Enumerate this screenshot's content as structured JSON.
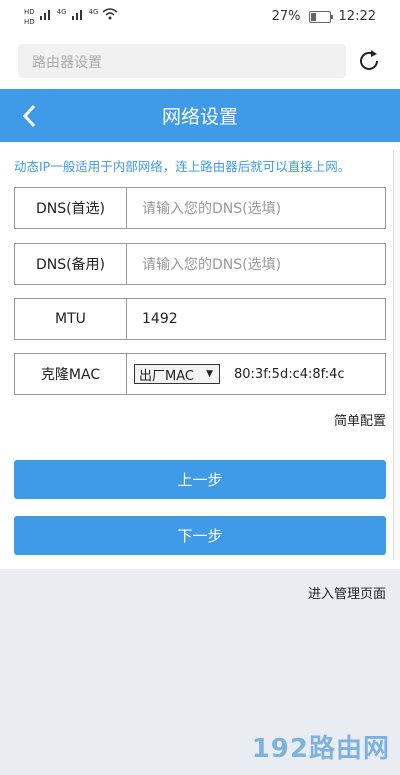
{
  "status": {
    "net1": "HD",
    "net2": "HD",
    "net3": "4G",
    "net4": "4G",
    "battery": "27%",
    "time": "12:22"
  },
  "browser": {
    "url_placeholder": "路由器设置"
  },
  "header": {
    "title": "网络设置"
  },
  "info_text": "动态IP一般适用于内部网络，连上路由器后就可以直接上网。",
  "form": {
    "dns_primary": {
      "label": "DNS(首选)",
      "placeholder": "请输入您的DNS(选填)"
    },
    "dns_backup": {
      "label": "DNS(备用)",
      "placeholder": "请输入您的DNS(选填)"
    },
    "mtu": {
      "label": "MTU",
      "value": "1492"
    },
    "clone_mac": {
      "label": "克隆MAC",
      "selected": "出厂MAC",
      "mac": "80:3f:5d:c4:8f:4c"
    }
  },
  "simple_config": "简单配置",
  "buttons": {
    "prev": "上一步",
    "next": "下一步"
  },
  "admin_link": "进入管理页面",
  "watermark": "192路由网",
  "colors": {
    "accent": "#3f9be8"
  }
}
